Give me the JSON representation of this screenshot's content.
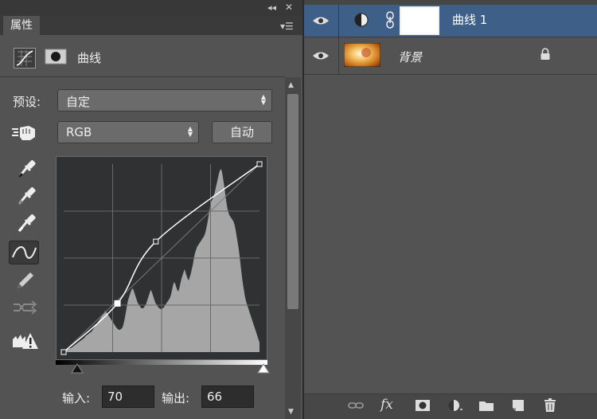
{
  "properties_panel": {
    "collapse_glyph": "◂◂",
    "close_glyph": "✕",
    "tab_label": "属性",
    "menu_glyph": "▾☰",
    "adjustment_title": "曲线",
    "preset_label": "预设:",
    "preset_value": "自定",
    "channel_value": "RGB",
    "auto_button_label": "自动",
    "tools": [
      "hand-target-icon",
      "eyedropper-black-icon",
      "eyedropper-gray-icon",
      "eyedropper-white-icon",
      "curve-edit-icon",
      "pencil-icon",
      "smooth-icon",
      "clipping-warning-icon"
    ],
    "input_label": "输入:",
    "input_value": "70",
    "output_label": "输出:",
    "output_value": "66",
    "scroll_up_glyph": "▲",
    "scroll_down_glyph": "▼"
  },
  "curve": {
    "points": [
      [
        0,
        0
      ],
      [
        70,
        66
      ],
      [
        120,
        150
      ],
      [
        255,
        255
      ]
    ],
    "histogram": [
      2,
      2,
      3,
      3,
      4,
      4,
      5,
      5,
      6,
      7,
      8,
      9,
      10,
      11,
      12,
      13,
      14,
      15,
      16,
      17,
      18,
      20,
      21,
      22,
      23,
      24,
      25,
      26,
      28,
      30,
      32,
      34,
      36,
      38,
      40,
      42,
      44,
      46,
      48,
      50,
      52,
      50,
      48,
      46,
      44,
      42,
      40,
      38,
      36,
      34,
      32,
      30,
      29,
      28,
      28,
      29,
      30,
      33,
      38,
      45,
      52,
      60,
      66,
      70,
      74,
      78,
      80,
      78,
      74,
      70,
      66,
      62,
      60,
      58,
      56,
      55,
      55,
      56,
      58,
      60,
      64,
      68,
      72,
      76,
      78,
      74,
      70,
      66,
      62,
      60,
      58,
      56,
      55,
      54,
      54,
      55,
      56,
      58,
      60,
      62,
      64,
      66,
      68,
      72,
      78,
      84,
      88,
      86,
      82,
      78,
      76,
      80,
      86,
      92,
      96,
      100,
      104,
      100,
      96,
      92,
      90,
      94,
      98,
      104,
      110,
      118,
      124,
      128,
      132,
      134,
      136,
      138,
      140,
      142,
      144,
      146,
      150,
      156,
      162,
      170,
      178,
      186,
      190,
      192,
      196,
      200,
      206,
      212,
      218,
      224,
      228,
      230,
      226,
      218,
      210,
      200,
      190,
      182,
      176,
      172,
      170,
      168,
      166,
      164,
      160,
      154,
      146,
      138,
      130,
      120,
      108,
      96,
      86,
      78,
      70,
      64,
      60,
      56,
      52,
      48,
      44,
      40,
      36,
      32,
      28,
      24,
      20,
      16,
      12
    ]
  },
  "layers_panel": {
    "layers": [
      {
        "name": "曲线 1",
        "selected": true
      },
      {
        "name": "背景",
        "locked": true
      }
    ],
    "bottom_icons": [
      "link-layers-icon",
      "fx-icon",
      "add-mask-icon",
      "new-adjustment-icon",
      "new-group-icon",
      "new-layer-icon",
      "delete-layer-icon"
    ],
    "fx_label": "fx"
  },
  "colors": {
    "panel_bg": "#535353",
    "selected_layer": "#3e5f87",
    "graph_bg": "#2f3132",
    "histogram": "#a6a6a6"
  }
}
